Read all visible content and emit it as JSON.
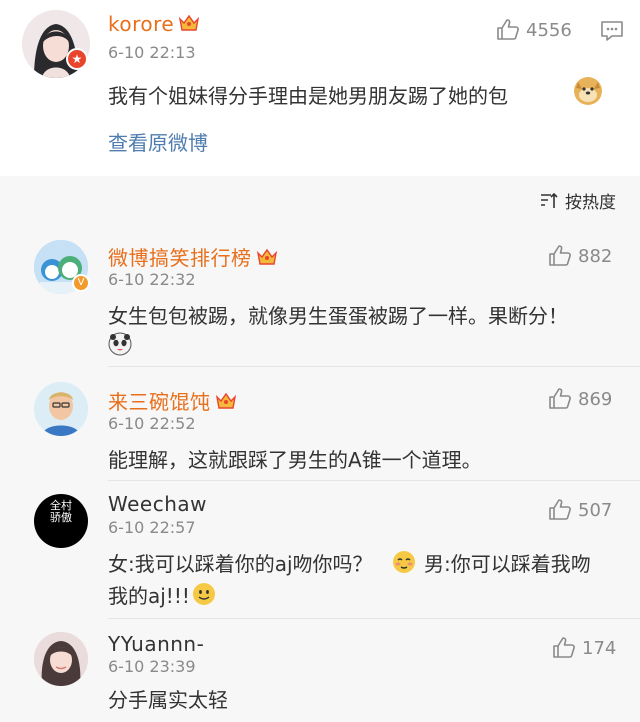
{
  "post": {
    "username": "korore",
    "time": "6-10 22:13",
    "likes": "4556",
    "text": "我有个姐妹得分手理由是她男朋友踢了她的包",
    "view_original": "查看原微博"
  },
  "sort_label": "按热度",
  "comments": [
    {
      "username": "微博搞笑排行榜",
      "time": "6-10 22:32",
      "likes": "882",
      "text": "女生包包被踢，就像男生蛋蛋被踢了一样。果断分！"
    },
    {
      "username": "来三碗馄饨",
      "time": "6-10 22:52",
      "likes": "869",
      "text": "能理解，这就跟踩了男生的A锥一个道理。"
    },
    {
      "username": "Weechaw",
      "time": "6-10 22:57",
      "likes": "507",
      "text_line1": "女:我可以踩着你的aj吻你吗？",
      "text_mid": "男:你可以踩着我吻",
      "text_line2": "我的aj!!!",
      "avatar_text": "全村骄傲"
    },
    {
      "username": "YYuannn-",
      "time": "6-10 23:39",
      "likes": "174",
      "text": "分手属实太轻"
    }
  ],
  "colors": {
    "vip_name": "#e86f1b",
    "link": "#507daf",
    "meta": "#8a8a8a"
  }
}
